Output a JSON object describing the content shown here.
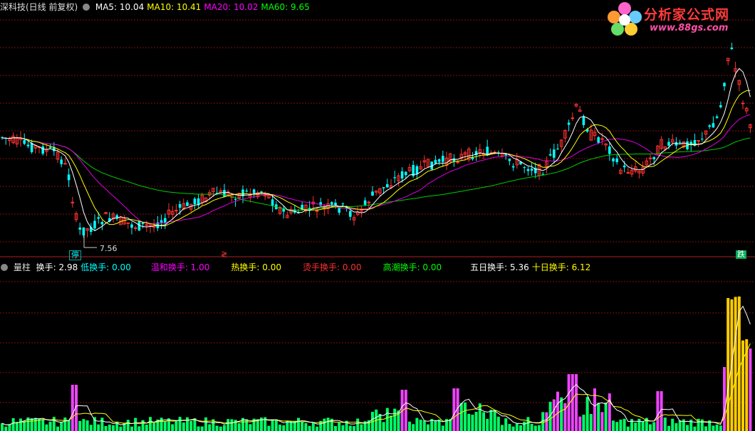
{
  "main_panel": {
    "title": "深科技(日线 前复权)",
    "ma_items": [
      {
        "label": "MA5: 10.04",
        "color": "#ffffff"
      },
      {
        "label": "MA10: 10.41",
        "color": "#ffff00"
      },
      {
        "label": "MA20: 10.02",
        "color": "#ff00ff"
      },
      {
        "label": "MA60: 9.65",
        "color": "#00ff00"
      }
    ],
    "low_price_label": "7.56",
    "markers": {
      "halt": "停",
      "red_mark": "≷",
      "fall": "跌"
    }
  },
  "sub_panel": {
    "title": "量柱",
    "items": [
      {
        "label": "换手: 2.98",
        "color": "#ffffff"
      },
      {
        "label": "低换手: 0.00",
        "color": "#00ffff"
      },
      {
        "label": "温和换手: 1.00",
        "color": "#ff00ff"
      },
      {
        "label": "热换手: 0.00",
        "color": "#ffff00"
      },
      {
        "label": "烫手换手: 0.00",
        "color": "#ff3030"
      },
      {
        "label": "高潮换手: 0.00",
        "color": "#00ff00"
      },
      {
        "label": "五日换手: 5.36",
        "color": "#ffffff"
      },
      {
        "label": "十日换手: 6.12",
        "color": "#ffff00"
      }
    ]
  },
  "logo": {
    "name": "分析家公式网",
    "url_text": "www.88gs.com"
  },
  "colors": {
    "up": "#ff3232",
    "down": "#00ffff",
    "grid": "#801010",
    "vol_green": "#00ff66",
    "vol_magenta": "#ee44ff",
    "vol_gold": "#ffcc00"
  }
}
